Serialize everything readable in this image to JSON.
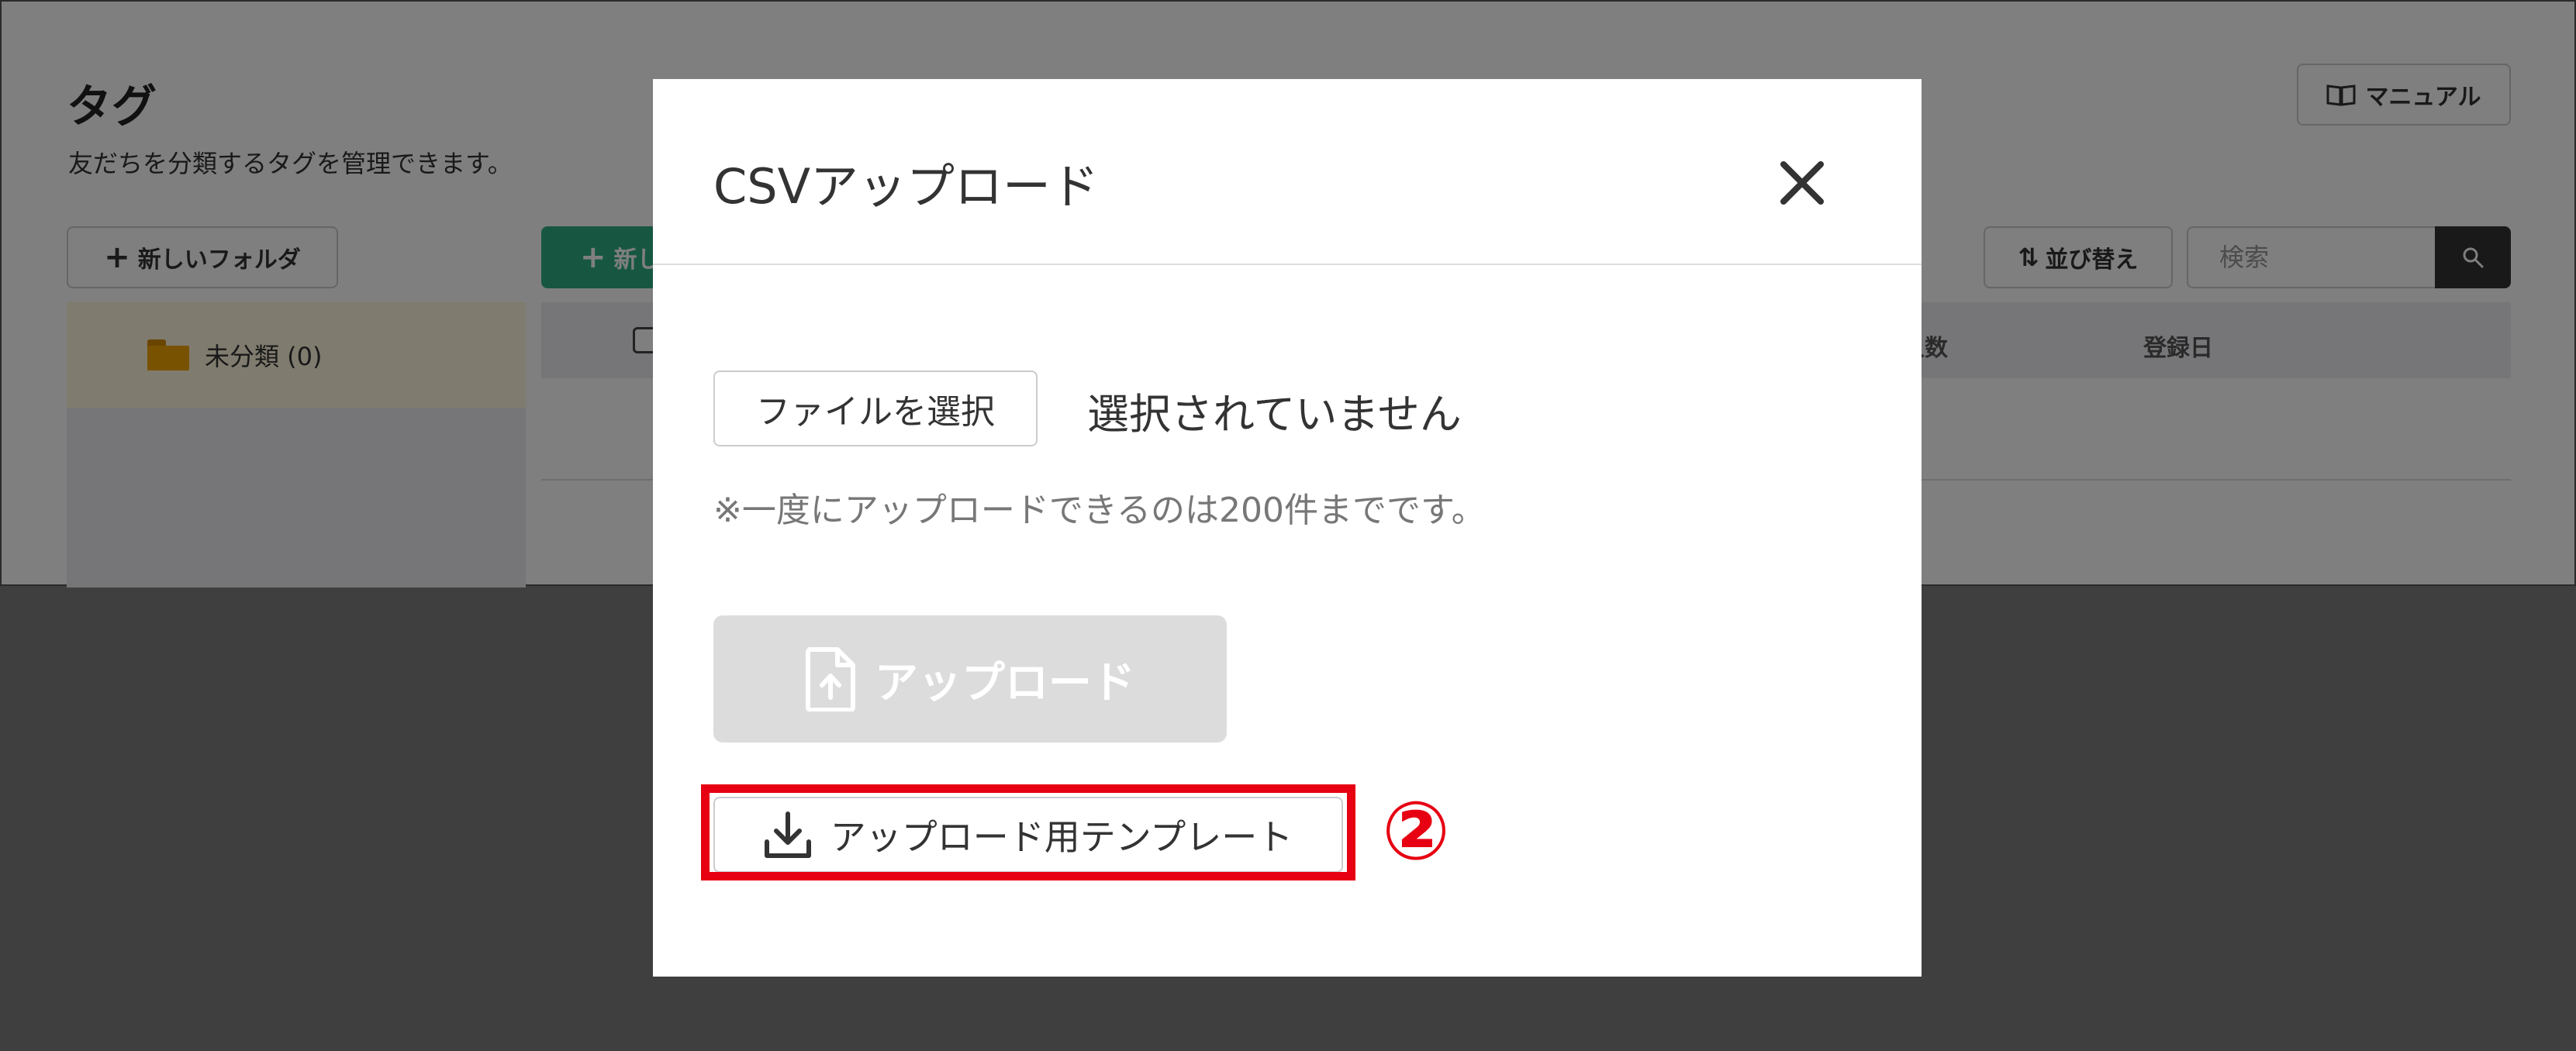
{
  "page": {
    "title": "タグ",
    "subtitle": "友だちを分類するタグを管理できます。",
    "manual_label": "マニュアル",
    "new_folder_label": "新しいフォルダ",
    "new_tag_label": "新し",
    "sort_label": "並び替え",
    "search_placeholder": "検索",
    "folder_item_label": "未分類 (0)",
    "table_headers": [
      "人数",
      "登録日"
    ]
  },
  "modal": {
    "title": "CSVアップロード",
    "file_button_label": "ファイルを選択",
    "file_status": "選択されていません",
    "note": "※一度にアップロードできるのは200件までです。",
    "upload_label": "アップロード",
    "template_label": "アップロード用テンプレート"
  },
  "annotation": {
    "step": "②",
    "color": "#e60012"
  },
  "colors": {
    "accent_green": "#2fae85",
    "overlay": "rgba(0,0,0,0.5)",
    "disabled_button": "#dcdcdc",
    "folder_selected_bg": "#fff7dd"
  }
}
